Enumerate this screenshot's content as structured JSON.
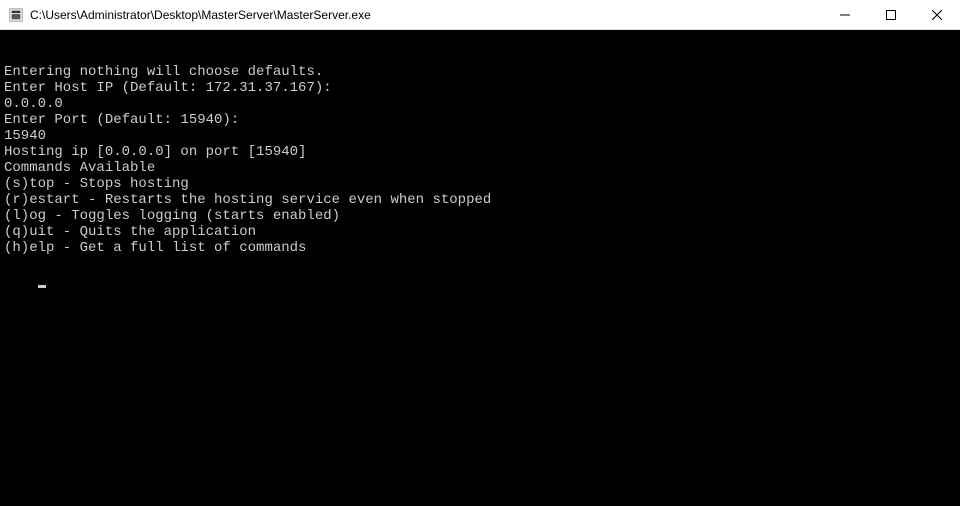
{
  "window": {
    "title": "C:\\Users\\Administrator\\Desktop\\MasterServer\\MasterServer.exe"
  },
  "console": {
    "lines": [
      "Entering nothing will choose defaults.",
      "Enter Host IP (Default: 172.31.37.167):",
      "0.0.0.0",
      "Enter Port (Default: 15940):",
      "15940",
      "Hosting ip [0.0.0.0] on port [15940]",
      "Commands Available",
      "(s)top - Stops hosting",
      "(r)estart - Restarts the hosting service even when stopped",
      "(l)og - Toggles logging (starts enabled)",
      "(q)uit - Quits the application",
      "(h)elp - Get a full list of commands"
    ]
  }
}
